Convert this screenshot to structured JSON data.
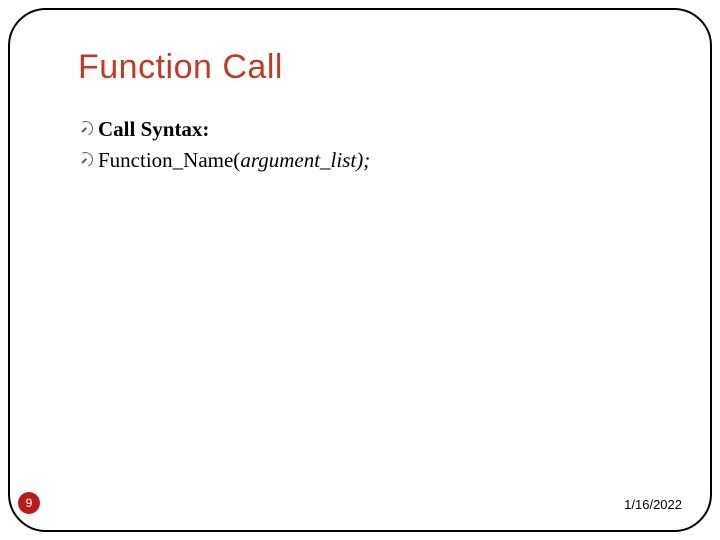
{
  "slide": {
    "title": "Function Call",
    "bullets": [
      {
        "bold": "Call Syntax:",
        "normal": "",
        "italic": ""
      },
      {
        "bold": "",
        "normal": "Function_Name(",
        "italic": "argument_list);",
        "suffix": ""
      }
    ],
    "page_number": "9",
    "date": "1/16/2022"
  }
}
